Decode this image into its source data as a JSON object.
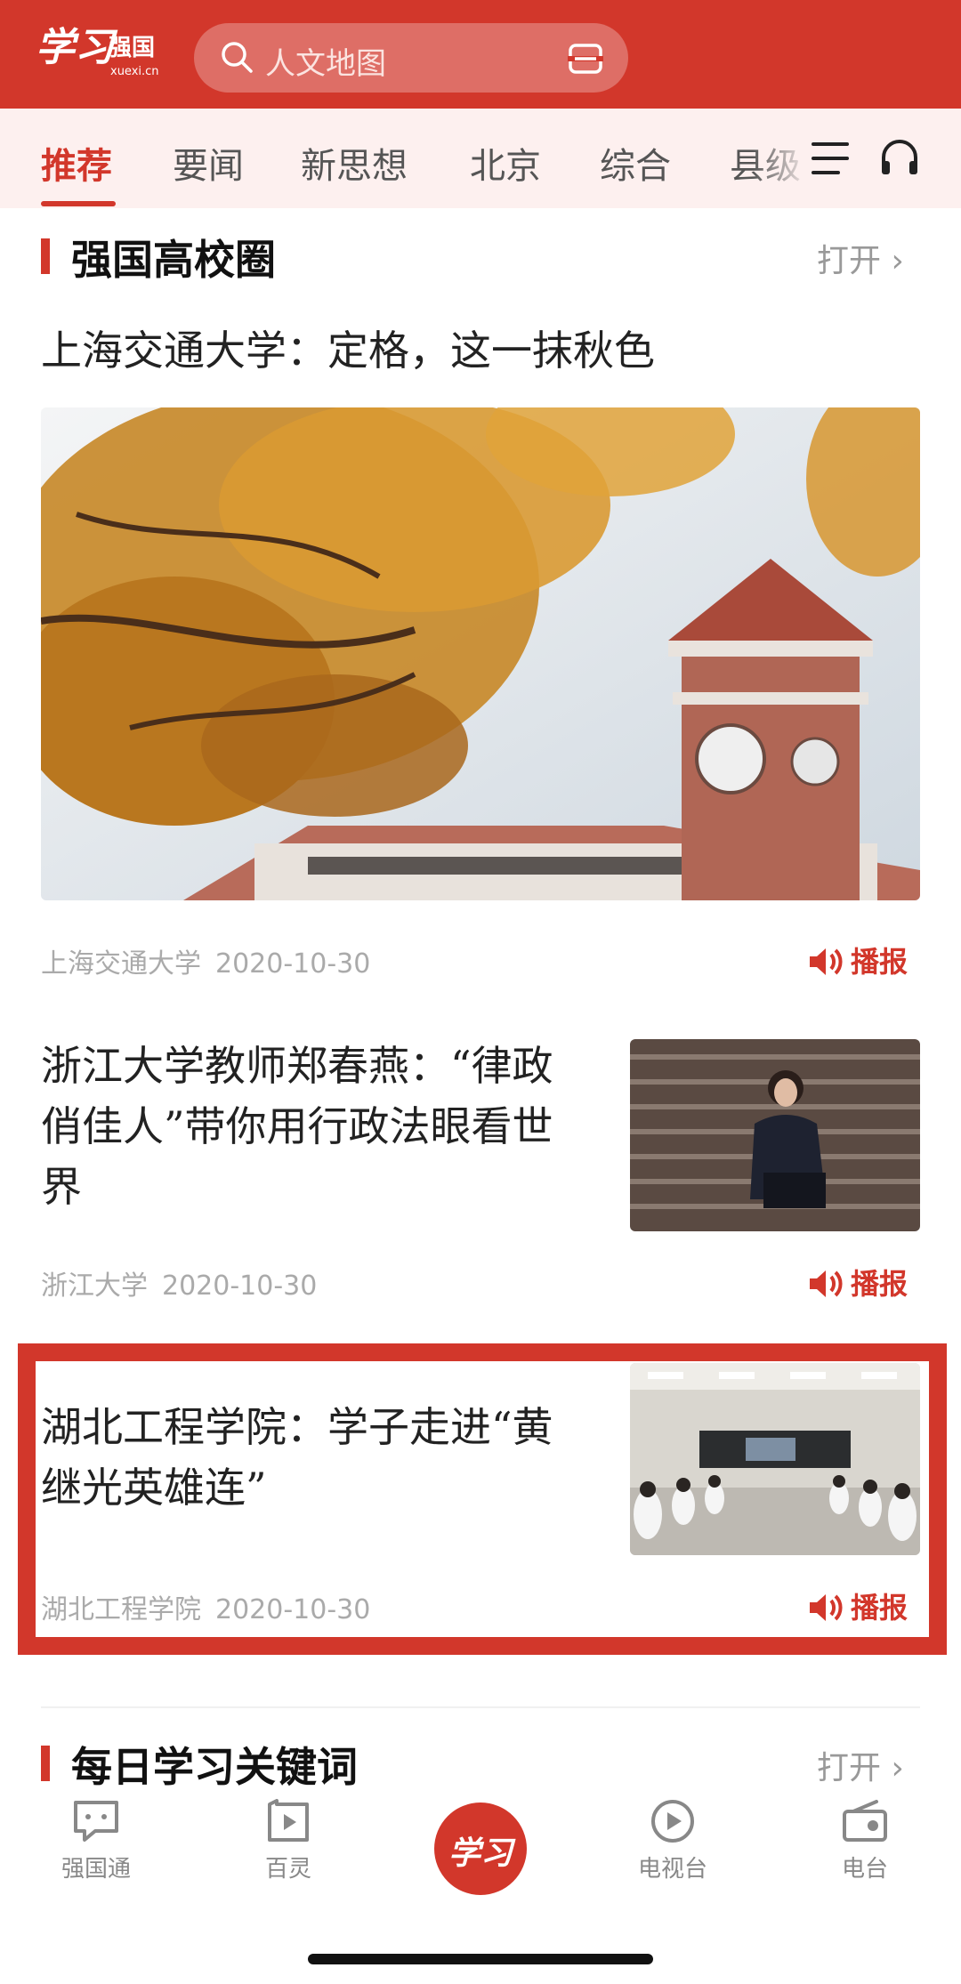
{
  "header": {
    "logo_text": "学习强国",
    "logo_domain": "xuexi.cn",
    "search_placeholder": "人文地图"
  },
  "tabs": [
    {
      "label": "推荐",
      "active": true
    },
    {
      "label": "要闻"
    },
    {
      "label": "新思想"
    },
    {
      "label": "北京"
    },
    {
      "label": "综合"
    },
    {
      "label": "县级"
    }
  ],
  "section1": {
    "title": "强国高校圈",
    "open_label": "打开 ›"
  },
  "articles": [
    {
      "title": "上海交通大学：定格，这一抹秋色",
      "source": "上海交通大学",
      "date": "2020-10-30",
      "broadcast_label": "播报"
    },
    {
      "title_lines": [
        "浙江大学教师郑春燕：“律政",
        "俏佳人”带你用行政法眼看世",
        "界"
      ],
      "source": "浙江大学",
      "date": "2020-10-30",
      "broadcast_label": "播报"
    },
    {
      "title_lines": [
        "湖北工程学院：学子走进“黄",
        "继光英雄连”"
      ],
      "source": "湖北工程学院",
      "date": "2020-10-30",
      "broadcast_label": "播报"
    }
  ],
  "section2": {
    "title": "每日学习关键词",
    "open_label": "打开 ›"
  },
  "bottom_nav": [
    {
      "label": "强国通",
      "icon": "chat-icon"
    },
    {
      "label": "百灵",
      "icon": "play-box-icon"
    },
    {
      "label": "学习",
      "icon": "study-center-icon"
    },
    {
      "label": "电视台",
      "icon": "tv-play-icon"
    },
    {
      "label": "电台",
      "icon": "radio-icon"
    }
  ],
  "colors": {
    "accent": "#d2372b",
    "tab_bg": "#fdf0ef"
  }
}
